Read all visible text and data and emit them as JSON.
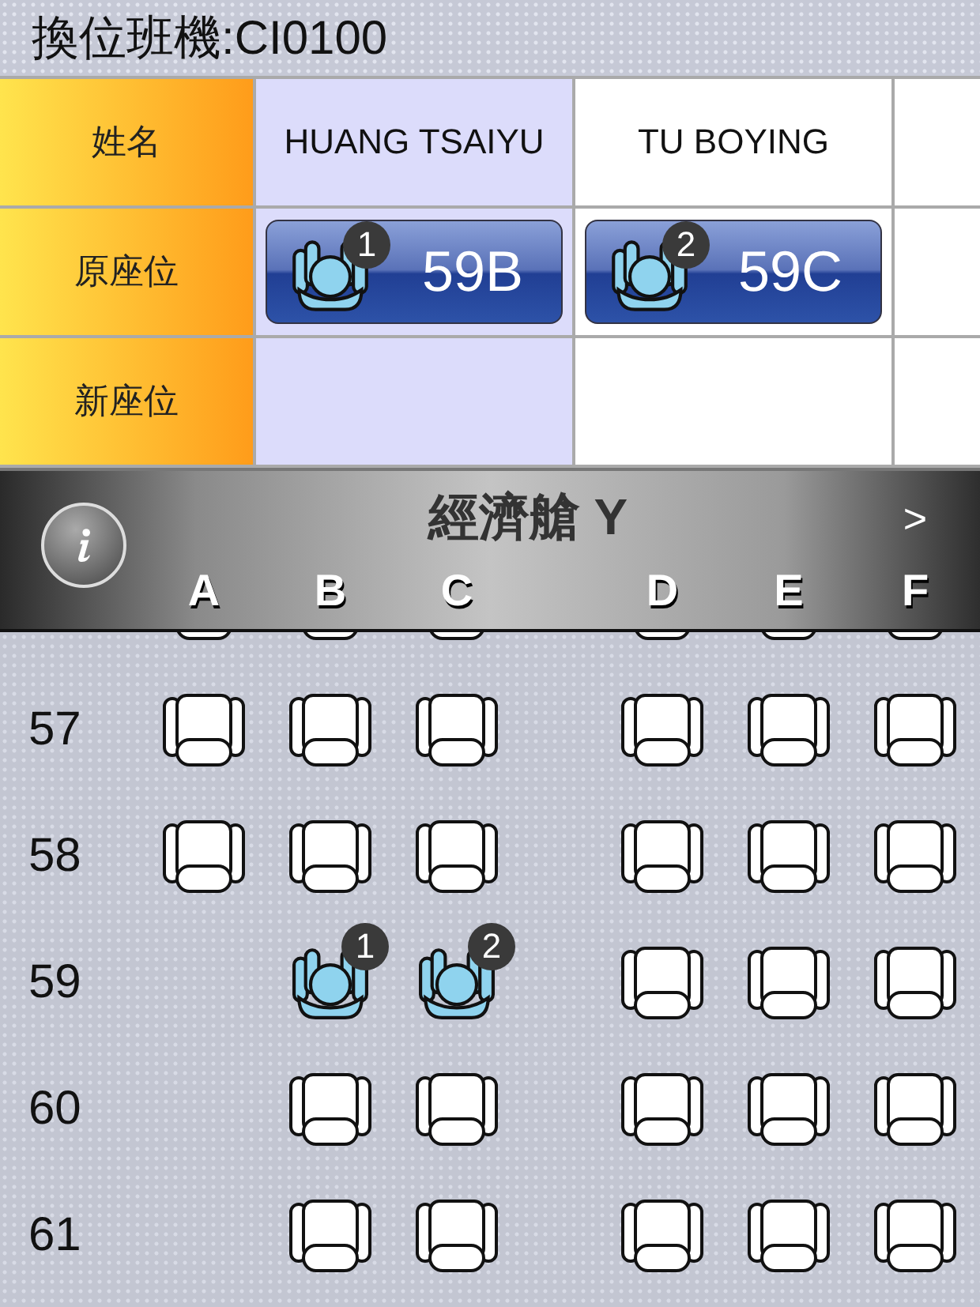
{
  "header": {
    "title": "換位班機:CI0100"
  },
  "table": {
    "row_labels": [
      "姓名",
      "原座位",
      "新座位"
    ],
    "passengers": [
      {
        "name": "HUANG TSAIYU",
        "original_seat": "59B",
        "badge": "1",
        "selected": true
      },
      {
        "name": "TU BOYING",
        "original_seat": "59C",
        "badge": "2",
        "selected": false
      }
    ]
  },
  "seat_map": {
    "cabin_title": "經濟艙 Y",
    "next_label": ">",
    "columns": [
      "A",
      "B",
      "C",
      "D",
      "E",
      "F"
    ],
    "rows": [
      {
        "seats": [
          {
            "kind": "empty"
          },
          {
            "kind": "empty"
          },
          {
            "kind": "empty"
          },
          {
            "kind": "empty"
          },
          {
            "kind": "empty"
          },
          {
            "kind": "empty"
          }
        ]
      },
      {
        "number": "57",
        "seats": [
          {
            "kind": "empty"
          },
          {
            "kind": "empty"
          },
          {
            "kind": "empty"
          },
          {
            "kind": "empty"
          },
          {
            "kind": "empty"
          },
          {
            "kind": "empty"
          }
        ]
      },
      {
        "number": "58",
        "seats": [
          {
            "kind": "empty"
          },
          {
            "kind": "empty"
          },
          {
            "kind": "empty"
          },
          {
            "kind": "empty"
          },
          {
            "kind": "empty"
          },
          {
            "kind": "empty"
          }
        ]
      },
      {
        "number": "59",
        "seats": [
          {
            "kind": "none"
          },
          {
            "kind": "person",
            "badge": "1"
          },
          {
            "kind": "person",
            "badge": "2"
          },
          {
            "kind": "empty"
          },
          {
            "kind": "empty"
          },
          {
            "kind": "empty"
          }
        ]
      },
      {
        "number": "60",
        "seats": [
          {
            "kind": "none"
          },
          {
            "kind": "empty"
          },
          {
            "kind": "empty"
          },
          {
            "kind": "empty"
          },
          {
            "kind": "empty"
          },
          {
            "kind": "empty"
          }
        ]
      },
      {
        "number": "61",
        "seats": [
          {
            "kind": "none"
          },
          {
            "kind": "empty"
          },
          {
            "kind": "empty"
          },
          {
            "kind": "empty"
          },
          {
            "kind": "empty"
          },
          {
            "kind": "empty"
          }
        ]
      }
    ]
  }
}
